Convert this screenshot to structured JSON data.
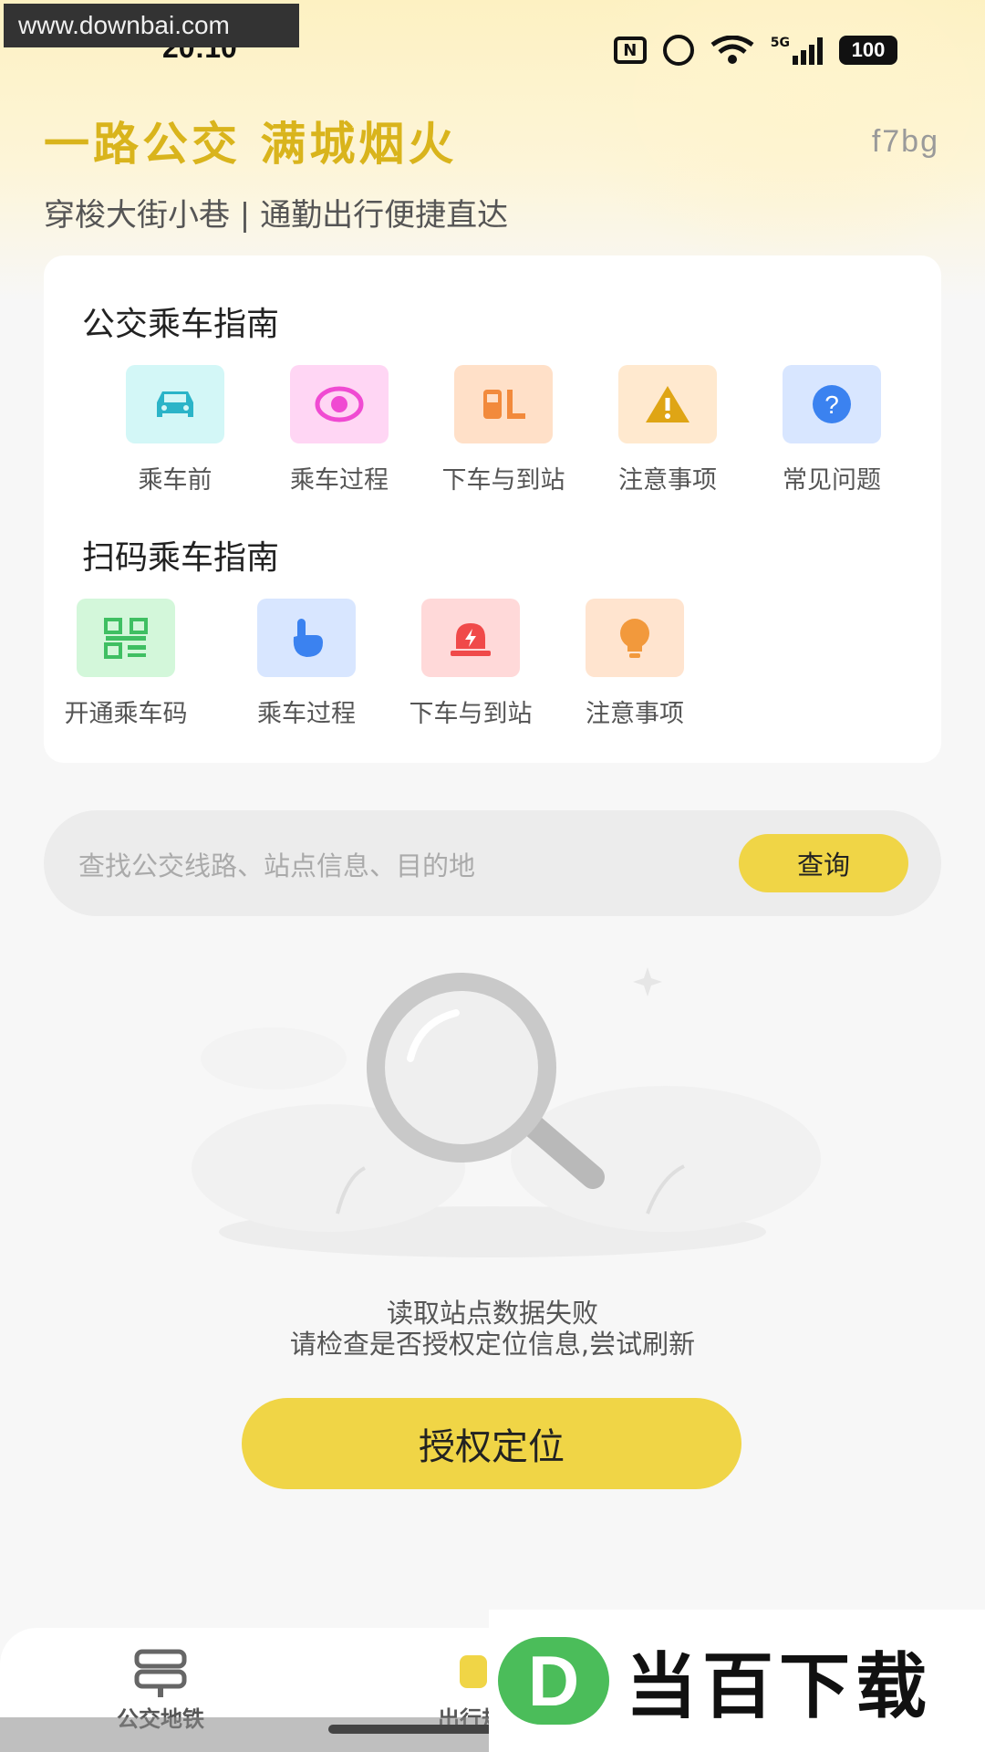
{
  "watermark": {
    "url": "www.downbai.com",
    "brand_letter": "D",
    "brand_name": "当百下载"
  },
  "status_bar": {
    "time": "20:10",
    "network": "5G",
    "battery": "100"
  },
  "header": {
    "title": "一路公交 满城烟火",
    "code": "f7bg",
    "subtitle": "穿梭大街小巷 | 通勤出行便捷直达"
  },
  "bus_guide": {
    "title": "公交乘车指南",
    "items": [
      {
        "label": "乘车前",
        "icon": "car-icon",
        "bg": "#d3f7f7",
        "fg": "#2bb4c8"
      },
      {
        "label": "乘车过程",
        "icon": "target-icon",
        "bg": "#ffd6f4",
        "fg": "#f04ad2"
      },
      {
        "label": "下车与到站",
        "icon": "bus-stop-icon",
        "bg": "#ffe0c8",
        "fg": "#f28a3c"
      },
      {
        "label": "注意事项",
        "icon": "warning-icon",
        "bg": "#ffe9cf",
        "fg": "#dfa515"
      },
      {
        "label": "常见问题",
        "icon": "question-icon",
        "bg": "#d8e6ff",
        "fg": "#3b82f0"
      }
    ]
  },
  "scan_guide": {
    "title": "扫码乘车指南",
    "items": [
      {
        "label": "开通乘车码",
        "icon": "qr-code-icon",
        "bg": "#d3f7da",
        "fg": "#3fbf62"
      },
      {
        "label": "乘车过程",
        "icon": "tap-hand-icon",
        "bg": "#d8e6ff",
        "fg": "#3b82f0"
      },
      {
        "label": "下车与到站",
        "icon": "alarm-light-icon",
        "bg": "#ffd9d9",
        "fg": "#f04a4a"
      },
      {
        "label": "注意事项",
        "icon": "bulb-icon",
        "bg": "#ffe4cf",
        "fg": "#f2993c"
      }
    ]
  },
  "search": {
    "placeholder": "查找公交线路、站点信息、目的地",
    "button": "查询"
  },
  "empty_state": {
    "line1": "读取站点数据失败",
    "line2": "请检查是否授权定位信息,尝试刷新",
    "button": "授权定位"
  },
  "bottom_nav": {
    "items": [
      {
        "label": "公交地铁",
        "icon": "signpost-icon"
      },
      {
        "label": "出行规划",
        "icon": "route-icon"
      }
    ]
  },
  "colors": {
    "accent": "#f0d546",
    "title": "#d9b41c"
  }
}
